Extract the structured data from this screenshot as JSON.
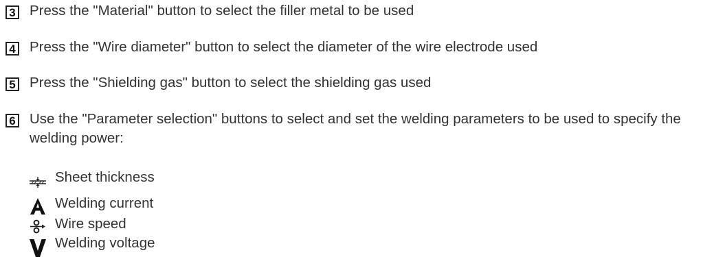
{
  "steps": [
    {
      "number": "3",
      "text": "Press the \"Material\" button to select the filler metal to be used"
    },
    {
      "number": "4",
      "text": "Press the \"Wire diameter\" button to select the diameter of the wire electrode used"
    },
    {
      "number": "5",
      "text": "Press the \"Shielding gas\" button to select the shielding gas used"
    },
    {
      "number": "6",
      "text": "Use the \"Parameter selection\" buttons to select and set the welding parameters to be used to specify the welding power:"
    }
  ],
  "parameters": [
    {
      "icon": "sheet-thickness-icon",
      "label": "Sheet thickness"
    },
    {
      "icon": "welding-current-icon",
      "label": "Welding current"
    },
    {
      "icon": "wire-speed-icon",
      "label": "Wire speed"
    },
    {
      "icon": "welding-voltage-icon",
      "label": "Welding voltage"
    }
  ]
}
